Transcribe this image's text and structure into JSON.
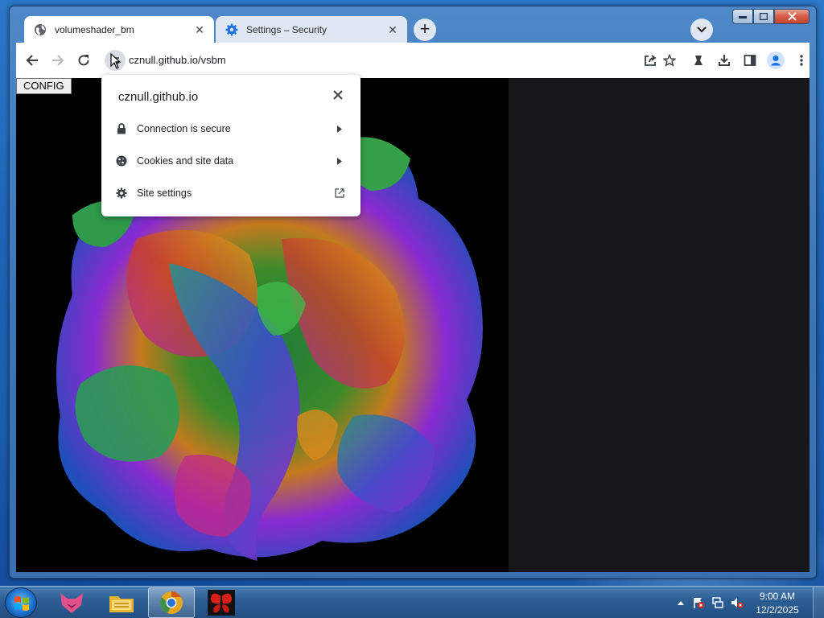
{
  "browser": {
    "tabs": [
      {
        "title": "volumeshader_bm",
        "icon": "globe-icon",
        "active": true
      },
      {
        "title": "Settings – Security",
        "icon": "gear-icon",
        "active": false
      }
    ],
    "close_glyph": "✕",
    "newtab_glyph": "+",
    "address": {
      "url": "cznull.github.io/vsbm"
    }
  },
  "page": {
    "config_button_label": "CONFIG"
  },
  "site_info_popup": {
    "title": "cznull.github.io",
    "rows": [
      {
        "label": "Connection is secure",
        "icon": "lock-icon",
        "trail": "chevron-right-icon"
      },
      {
        "label": "Cookies and site data",
        "icon": "cookie-icon",
        "trail": "chevron-right-icon"
      },
      {
        "label": "Site settings",
        "icon": "gear-icon",
        "trail": "external-link-icon"
      }
    ]
  },
  "taskbar": {
    "pinned": [
      "fox-app-icon",
      "file-explorer-icon",
      "chrome-canary-icon",
      "butterfly-app-icon"
    ],
    "clock": {
      "time": "9:00 AM",
      "date": "12/2/2025"
    }
  },
  "colors": {
    "accent_blue": "#1a73e8",
    "desktop_blue": "#1e63b5",
    "profile_blue": "#1a73e8"
  }
}
